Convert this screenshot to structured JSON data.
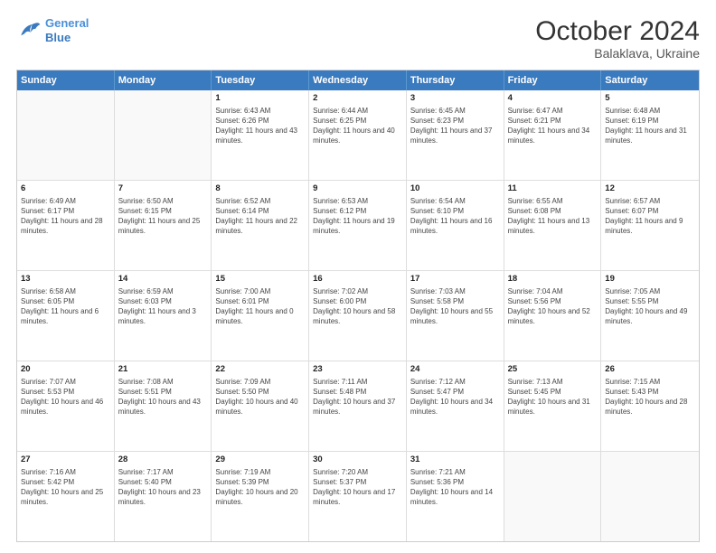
{
  "header": {
    "logo_line1": "General",
    "logo_line2": "Blue",
    "month_title": "October 2024",
    "location": "Balaklava, Ukraine"
  },
  "weekdays": [
    "Sunday",
    "Monday",
    "Tuesday",
    "Wednesday",
    "Thursday",
    "Friday",
    "Saturday"
  ],
  "rows": [
    [
      {
        "day": "",
        "empty": true
      },
      {
        "day": "",
        "empty": true
      },
      {
        "day": "1",
        "line1": "Sunrise: 6:43 AM",
        "line2": "Sunset: 6:26 PM",
        "line3": "Daylight: 11 hours",
        "line4": "and 43 minutes."
      },
      {
        "day": "2",
        "line1": "Sunrise: 6:44 AM",
        "line2": "Sunset: 6:25 PM",
        "line3": "Daylight: 11 hours",
        "line4": "and 40 minutes."
      },
      {
        "day": "3",
        "line1": "Sunrise: 6:45 AM",
        "line2": "Sunset: 6:23 PM",
        "line3": "Daylight: 11 hours",
        "line4": "and 37 minutes."
      },
      {
        "day": "4",
        "line1": "Sunrise: 6:47 AM",
        "line2": "Sunset: 6:21 PM",
        "line3": "Daylight: 11 hours",
        "line4": "and 34 minutes."
      },
      {
        "day": "5",
        "line1": "Sunrise: 6:48 AM",
        "line2": "Sunset: 6:19 PM",
        "line3": "Daylight: 11 hours",
        "line4": "and 31 minutes."
      }
    ],
    [
      {
        "day": "6",
        "line1": "Sunrise: 6:49 AM",
        "line2": "Sunset: 6:17 PM",
        "line3": "Daylight: 11 hours",
        "line4": "and 28 minutes."
      },
      {
        "day": "7",
        "line1": "Sunrise: 6:50 AM",
        "line2": "Sunset: 6:15 PM",
        "line3": "Daylight: 11 hours",
        "line4": "and 25 minutes."
      },
      {
        "day": "8",
        "line1": "Sunrise: 6:52 AM",
        "line2": "Sunset: 6:14 PM",
        "line3": "Daylight: 11 hours",
        "line4": "and 22 minutes."
      },
      {
        "day": "9",
        "line1": "Sunrise: 6:53 AM",
        "line2": "Sunset: 6:12 PM",
        "line3": "Daylight: 11 hours",
        "line4": "and 19 minutes."
      },
      {
        "day": "10",
        "line1": "Sunrise: 6:54 AM",
        "line2": "Sunset: 6:10 PM",
        "line3": "Daylight: 11 hours",
        "line4": "and 16 minutes."
      },
      {
        "day": "11",
        "line1": "Sunrise: 6:55 AM",
        "line2": "Sunset: 6:08 PM",
        "line3": "Daylight: 11 hours",
        "line4": "and 13 minutes."
      },
      {
        "day": "12",
        "line1": "Sunrise: 6:57 AM",
        "line2": "Sunset: 6:07 PM",
        "line3": "Daylight: 11 hours",
        "line4": "and 9 minutes."
      }
    ],
    [
      {
        "day": "13",
        "line1": "Sunrise: 6:58 AM",
        "line2": "Sunset: 6:05 PM",
        "line3": "Daylight: 11 hours",
        "line4": "and 6 minutes."
      },
      {
        "day": "14",
        "line1": "Sunrise: 6:59 AM",
        "line2": "Sunset: 6:03 PM",
        "line3": "Daylight: 11 hours",
        "line4": "and 3 minutes."
      },
      {
        "day": "15",
        "line1": "Sunrise: 7:00 AM",
        "line2": "Sunset: 6:01 PM",
        "line3": "Daylight: 11 hours",
        "line4": "and 0 minutes."
      },
      {
        "day": "16",
        "line1": "Sunrise: 7:02 AM",
        "line2": "Sunset: 6:00 PM",
        "line3": "Daylight: 10 hours",
        "line4": "and 58 minutes."
      },
      {
        "day": "17",
        "line1": "Sunrise: 7:03 AM",
        "line2": "Sunset: 5:58 PM",
        "line3": "Daylight: 10 hours",
        "line4": "and 55 minutes."
      },
      {
        "day": "18",
        "line1": "Sunrise: 7:04 AM",
        "line2": "Sunset: 5:56 PM",
        "line3": "Daylight: 10 hours",
        "line4": "and 52 minutes."
      },
      {
        "day": "19",
        "line1": "Sunrise: 7:05 AM",
        "line2": "Sunset: 5:55 PM",
        "line3": "Daylight: 10 hours",
        "line4": "and 49 minutes."
      }
    ],
    [
      {
        "day": "20",
        "line1": "Sunrise: 7:07 AM",
        "line2": "Sunset: 5:53 PM",
        "line3": "Daylight: 10 hours",
        "line4": "and 46 minutes."
      },
      {
        "day": "21",
        "line1": "Sunrise: 7:08 AM",
        "line2": "Sunset: 5:51 PM",
        "line3": "Daylight: 10 hours",
        "line4": "and 43 minutes."
      },
      {
        "day": "22",
        "line1": "Sunrise: 7:09 AM",
        "line2": "Sunset: 5:50 PM",
        "line3": "Daylight: 10 hours",
        "line4": "and 40 minutes."
      },
      {
        "day": "23",
        "line1": "Sunrise: 7:11 AM",
        "line2": "Sunset: 5:48 PM",
        "line3": "Daylight: 10 hours",
        "line4": "and 37 minutes."
      },
      {
        "day": "24",
        "line1": "Sunrise: 7:12 AM",
        "line2": "Sunset: 5:47 PM",
        "line3": "Daylight: 10 hours",
        "line4": "and 34 minutes."
      },
      {
        "day": "25",
        "line1": "Sunrise: 7:13 AM",
        "line2": "Sunset: 5:45 PM",
        "line3": "Daylight: 10 hours",
        "line4": "and 31 minutes."
      },
      {
        "day": "26",
        "line1": "Sunrise: 7:15 AM",
        "line2": "Sunset: 5:43 PM",
        "line3": "Daylight: 10 hours",
        "line4": "and 28 minutes."
      }
    ],
    [
      {
        "day": "27",
        "line1": "Sunrise: 7:16 AM",
        "line2": "Sunset: 5:42 PM",
        "line3": "Daylight: 10 hours",
        "line4": "and 25 minutes."
      },
      {
        "day": "28",
        "line1": "Sunrise: 7:17 AM",
        "line2": "Sunset: 5:40 PM",
        "line3": "Daylight: 10 hours",
        "line4": "and 23 minutes."
      },
      {
        "day": "29",
        "line1": "Sunrise: 7:19 AM",
        "line2": "Sunset: 5:39 PM",
        "line3": "Daylight: 10 hours",
        "line4": "and 20 minutes."
      },
      {
        "day": "30",
        "line1": "Sunrise: 7:20 AM",
        "line2": "Sunset: 5:37 PM",
        "line3": "Daylight: 10 hours",
        "line4": "and 17 minutes."
      },
      {
        "day": "31",
        "line1": "Sunrise: 7:21 AM",
        "line2": "Sunset: 5:36 PM",
        "line3": "Daylight: 10 hours",
        "line4": "and 14 minutes."
      },
      {
        "day": "",
        "empty": true
      },
      {
        "day": "",
        "empty": true
      }
    ]
  ]
}
